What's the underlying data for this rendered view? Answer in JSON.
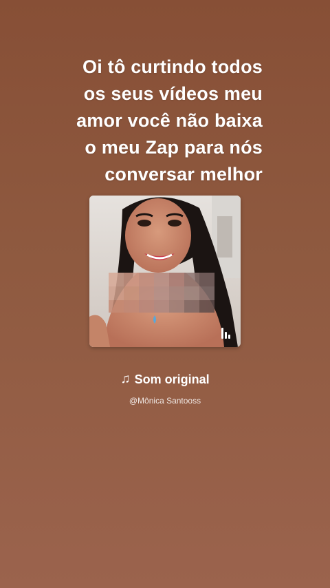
{
  "caption": {
    "lines": [
      "Oi tô curtindo todos",
      "os seus vídeos meu",
      "amor você não baixa",
      "o meu Zap para nós",
      "conversar melhor"
    ]
  },
  "sound": {
    "icon": "music-note-icon",
    "label": "Som original"
  },
  "author": {
    "handle": "@Mônica Santooss"
  },
  "thumbnail": {
    "overlay_icon": "audio-bars-icon"
  },
  "colors": {
    "background_top": "#874f36",
    "background_bottom": "#9b634d",
    "text": "#ffffff"
  }
}
